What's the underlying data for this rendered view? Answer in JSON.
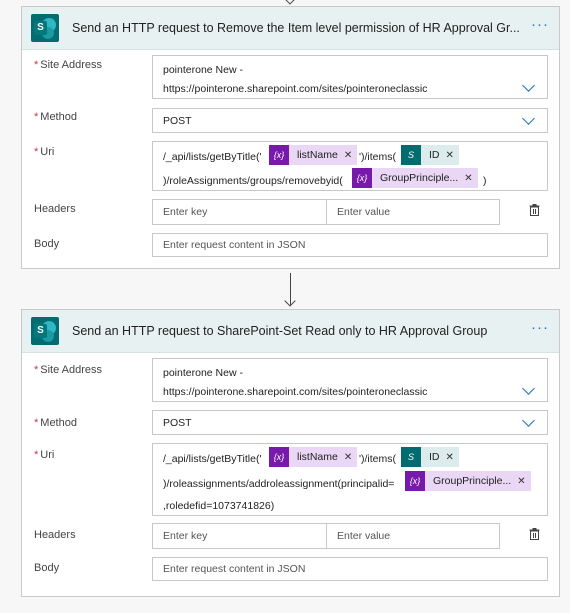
{
  "actions": [
    {
      "title": "Send an HTTP request to Remove the Item level permission of HR Approval Gr...",
      "site_label": "Site Address",
      "site_line1": "pointerone New -",
      "site_line2": "https://pointerone.sharepoint.com/sites/pointeroneclassic",
      "method_label": "Method",
      "method_value": "POST",
      "uri_label": "Uri",
      "uri_text1": "/_api/lists/getByTitle('",
      "uri_token1": "listName",
      "uri_text2": "')/items(",
      "uri_token2": "ID",
      "uri_text3": ")/roleAssignments/groups/removebyid(",
      "uri_token3": "GroupPrinciple...",
      "uri_text4": ")",
      "headers_label": "Headers",
      "key_placeholder": "Enter key",
      "value_placeholder": "Enter value",
      "body_label": "Body",
      "body_placeholder": "Enter request content in JSON"
    },
    {
      "title": "Send an HTTP request to SharePoint-Set Read only to HR Approval Group",
      "site_label": "Site Address",
      "site_line1": "pointerone New -",
      "site_line2": "https://pointerone.sharepoint.com/sites/pointeroneclassic",
      "method_label": "Method",
      "method_value": "POST",
      "uri_label": "Uri",
      "uri_text1": "/_api/lists/getByTitle('",
      "uri_token1": "listName",
      "uri_text2": "')/items(",
      "uri_token2": "ID",
      "uri_text3": ")/roleassignments/addroleassignment(principalid=",
      "uri_token3": "GroupPrinciple...",
      "uri_text4": ",roledefid=1073741826)",
      "headers_label": "Headers",
      "key_placeholder": "Enter key",
      "value_placeholder": "Enter value",
      "body_label": "Body",
      "body_placeholder": "Enter request content in JSON"
    }
  ],
  "icons": {
    "more": "more-dots-icon",
    "expression": "expression-icon",
    "sharepoint": "sharepoint-icon",
    "delete": "trash-icon",
    "chevron": "chevron-down-icon"
  },
  "colors": {
    "accent": "#1a73c8",
    "header_bg": "#e7f1f1",
    "sharepoint": "#036c70",
    "expression": "#7719aa",
    "required": "#d13438"
  }
}
